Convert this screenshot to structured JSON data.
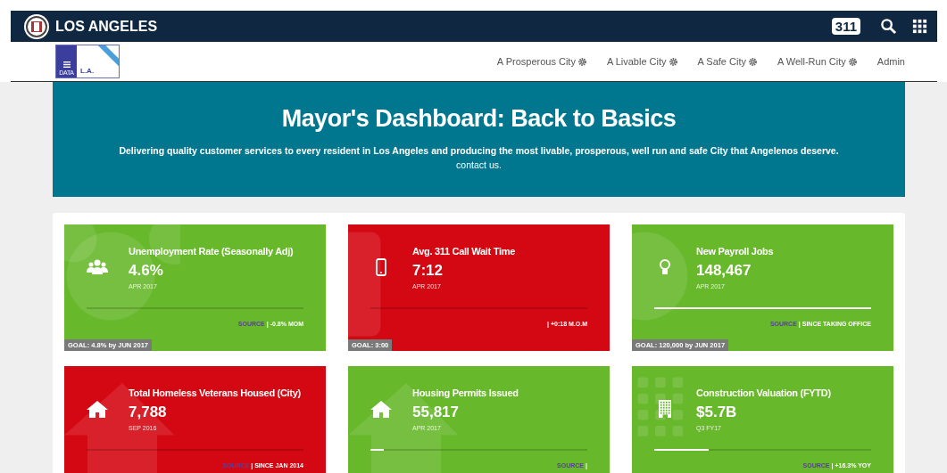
{
  "topbar": {
    "title": "LOS ANGELES",
    "badge": "311"
  },
  "nav": {
    "logo_left": "DATA",
    "logo_right": "L.A.",
    "items": [
      {
        "label": "A Prosperous City",
        "gear": true
      },
      {
        "label": "A Livable City",
        "gear": true
      },
      {
        "label": "A Safe City",
        "gear": true
      },
      {
        "label": "A Well-Run City",
        "gear": true
      },
      {
        "label": "Admin",
        "gear": false
      }
    ]
  },
  "hero": {
    "title": "Mayor's Dashboard: Back to Basics",
    "subtitle": "Delivering quality customer services to every resident in Los Angeles and producing the most livable, prosperous, well run and safe City that Angelenos deserve.",
    "link": "contact us."
  },
  "tiles": [
    {
      "kind": "people",
      "color": "#67b82b",
      "title": "Unemployment Rate (Seasonally Adj)",
      "value": "4.6%",
      "date": "APR 2017",
      "level": 0,
      "source": "SOURCE",
      "change": "| -0.8% MOM",
      "goal": "GOAL: 4.8% by JUN 2017"
    },
    {
      "kind": "phone",
      "color": "#d40812",
      "title": "Avg. 311 Call Wait Time",
      "value": "7:12",
      "date": "APR 2017",
      "level": 0,
      "change": "| +0:18 M.O.M",
      "goal": "GOAL: 3:00"
    },
    {
      "kind": "bulb",
      "color": "#67b82b",
      "title": "New Payroll Jobs",
      "value": "148,467",
      "date": "APR 2017",
      "level": 1,
      "source": "SOURCE",
      "change": "| SINCE TAKING OFFICE",
      "goal": "GOAL: 120,000 by JUN 2017"
    },
    {
      "kind": "house",
      "color": "#d40812",
      "title": "Total Homeless Veterans Housed (City)",
      "value": "7,788",
      "date": "SEP 2016",
      "level": 0,
      "source": "SOURCE",
      "change": "| SINCE JAN 2014"
    },
    {
      "kind": "house",
      "color": "#67b82b",
      "title": "Housing Permits Issued",
      "value": "55,817",
      "date": "APR 2017",
      "level": 0.06,
      "source": "SOURCE",
      "change": "|"
    },
    {
      "kind": "building",
      "color": "#67b82b",
      "title": "Construction Valuation (FYTD)",
      "value": "$5.7B",
      "date": "Q3 FY17",
      "level": 0.25,
      "source": "SOURCE",
      "change": "| +16.3% YOY"
    }
  ]
}
